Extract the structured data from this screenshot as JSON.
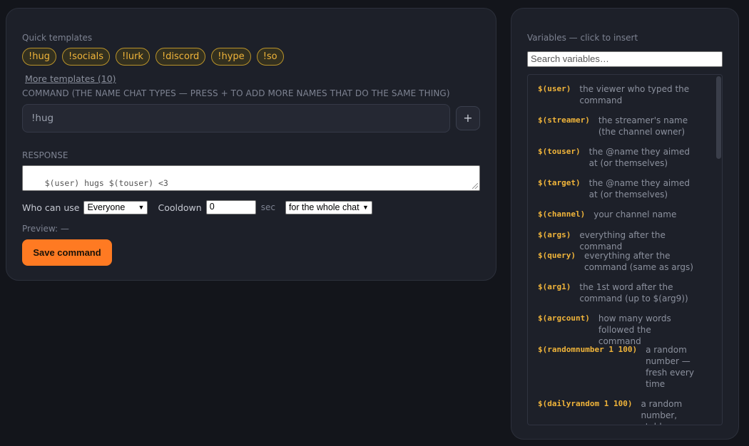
{
  "editor": {
    "quick_templates_label": "Quick templates",
    "templates": [
      "!hug",
      "!socials",
      "!lurk",
      "!discord",
      "!hype",
      "!so"
    ],
    "more_templates": "More templates (10)",
    "command_label": "Command (the name chat types — press + to add more names that do the same thing)",
    "command_value": "!hug",
    "add_name_label": "+",
    "response_label": "Response",
    "response_value": "$(user) hugs $(touser) <3",
    "who_label": "Who can use",
    "who_value": "Everyone",
    "cooldown_label": "Cooldown",
    "cooldown_value": "0",
    "cooldown_unit": "sec",
    "cooldown_scope": "for the whole chat",
    "preview_text": "Preview: —",
    "save_label": "Save command",
    "accent_color": "#ff7a22",
    "chip_color": "#f0b43a"
  },
  "variables": {
    "title": "Variables — click to insert",
    "search_placeholder": "Search variables…",
    "items": [
      {
        "code": "$(user)",
        "desc": "the viewer who typed the command"
      },
      {
        "code": "$(streamer)",
        "desc": "the streamer's name (the channel owner)"
      },
      {
        "code": "$(touser)",
        "desc": "the @name they aimed at (or themselves)"
      },
      {
        "code": "$(target)",
        "desc": "the @name they aimed at (or themselves)"
      },
      {
        "code": "$(channel)",
        "desc": "your channel name"
      },
      {
        "code": "$(args)",
        "desc": "everything after the command"
      },
      {
        "code": "$(query)",
        "desc": "everything after the command (same as args)"
      },
      {
        "code": "$(arg1)",
        "desc": "the 1st word after the command (up to $(arg9))"
      },
      {
        "code": "$(argcount)",
        "desc": "how many words followed the command"
      },
      {
        "code": "$(randomnumber 1 100)",
        "desc": "a random number — fresh every time"
      },
      {
        "code": "$(dailyrandom 1 100)",
        "desc": "a random number, stable"
      }
    ]
  }
}
